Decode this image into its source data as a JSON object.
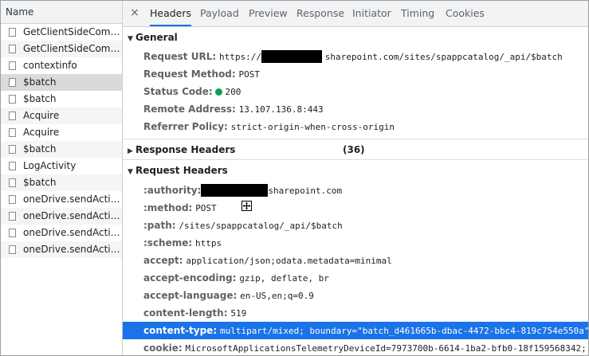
{
  "left_panel": {
    "header": "Name",
    "requests": [
      {
        "label": "GetClientSideCompo..."
      },
      {
        "label": "GetClientSideCompo..."
      },
      {
        "label": "contextinfo"
      },
      {
        "label": "$batch",
        "selected": true
      },
      {
        "label": "$batch"
      },
      {
        "label": "Acquire"
      },
      {
        "label": "Acquire"
      },
      {
        "label": "$batch"
      },
      {
        "label": "LogActivity"
      },
      {
        "label": "$batch"
      },
      {
        "label": "oneDrive.sendActivit..."
      },
      {
        "label": "oneDrive.sendActivit..."
      },
      {
        "label": "oneDrive.sendActivit..."
      },
      {
        "label": "oneDrive.sendActivit..."
      }
    ]
  },
  "tabs": {
    "close": "×",
    "items": [
      "Headers",
      "Payload",
      "Preview",
      "Response",
      "Initiator",
      "Timing",
      "Cookies"
    ],
    "active": "Headers"
  },
  "general": {
    "title": "General",
    "request_url_key": "Request URL:",
    "request_url_prefix": "https://",
    "request_url_suffix": "sharepoint.com/sites/spappcatalog/_api/$batch",
    "request_method_key": "Request Method:",
    "request_method": "POST",
    "status_code_key": "Status Code:",
    "status_code": "200",
    "remote_address_key": "Remote Address:",
    "remote_address": "13.107.136.8:443",
    "referrer_policy_key": "Referrer Policy:",
    "referrer_policy": "strict-origin-when-cross-origin"
  },
  "response_headers": {
    "title": "Response Headers",
    "count": "(36)"
  },
  "request_headers": {
    "title": "Request Headers",
    "authority_key": ":authority:",
    "authority_suffix": "sharepoint.com",
    "method_key": ":method:",
    "method": "POST",
    "path_key": ":path:",
    "path": "/sites/spappcatalog/_api/$batch",
    "scheme_key": ":scheme:",
    "scheme": "https",
    "accept_key": "accept:",
    "accept": "application/json;odata.metadata=minimal",
    "accept_encoding_key": "accept-encoding:",
    "accept_encoding": "gzip, deflate, br",
    "accept_language_key": "accept-language:",
    "accept_language": "en-US,en;q=0.9",
    "content_length_key": "content-length:",
    "content_length": "519",
    "content_type_key": "content-type:",
    "content_type": "multipart/mixed; boundary=\"batch_d461665b-dbac-4472-bbc4-819c754e550a\"",
    "cookie_key": "cookie:",
    "cookie": "MicrosoftApplicationsTelemetryDeviceId=7973700b-6614-1ba2-bfb0-18f159568342;"
  },
  "colors": {
    "accent": "#1a73e8",
    "status_ok": "#0f9d58",
    "selected_row": "#dadada"
  }
}
